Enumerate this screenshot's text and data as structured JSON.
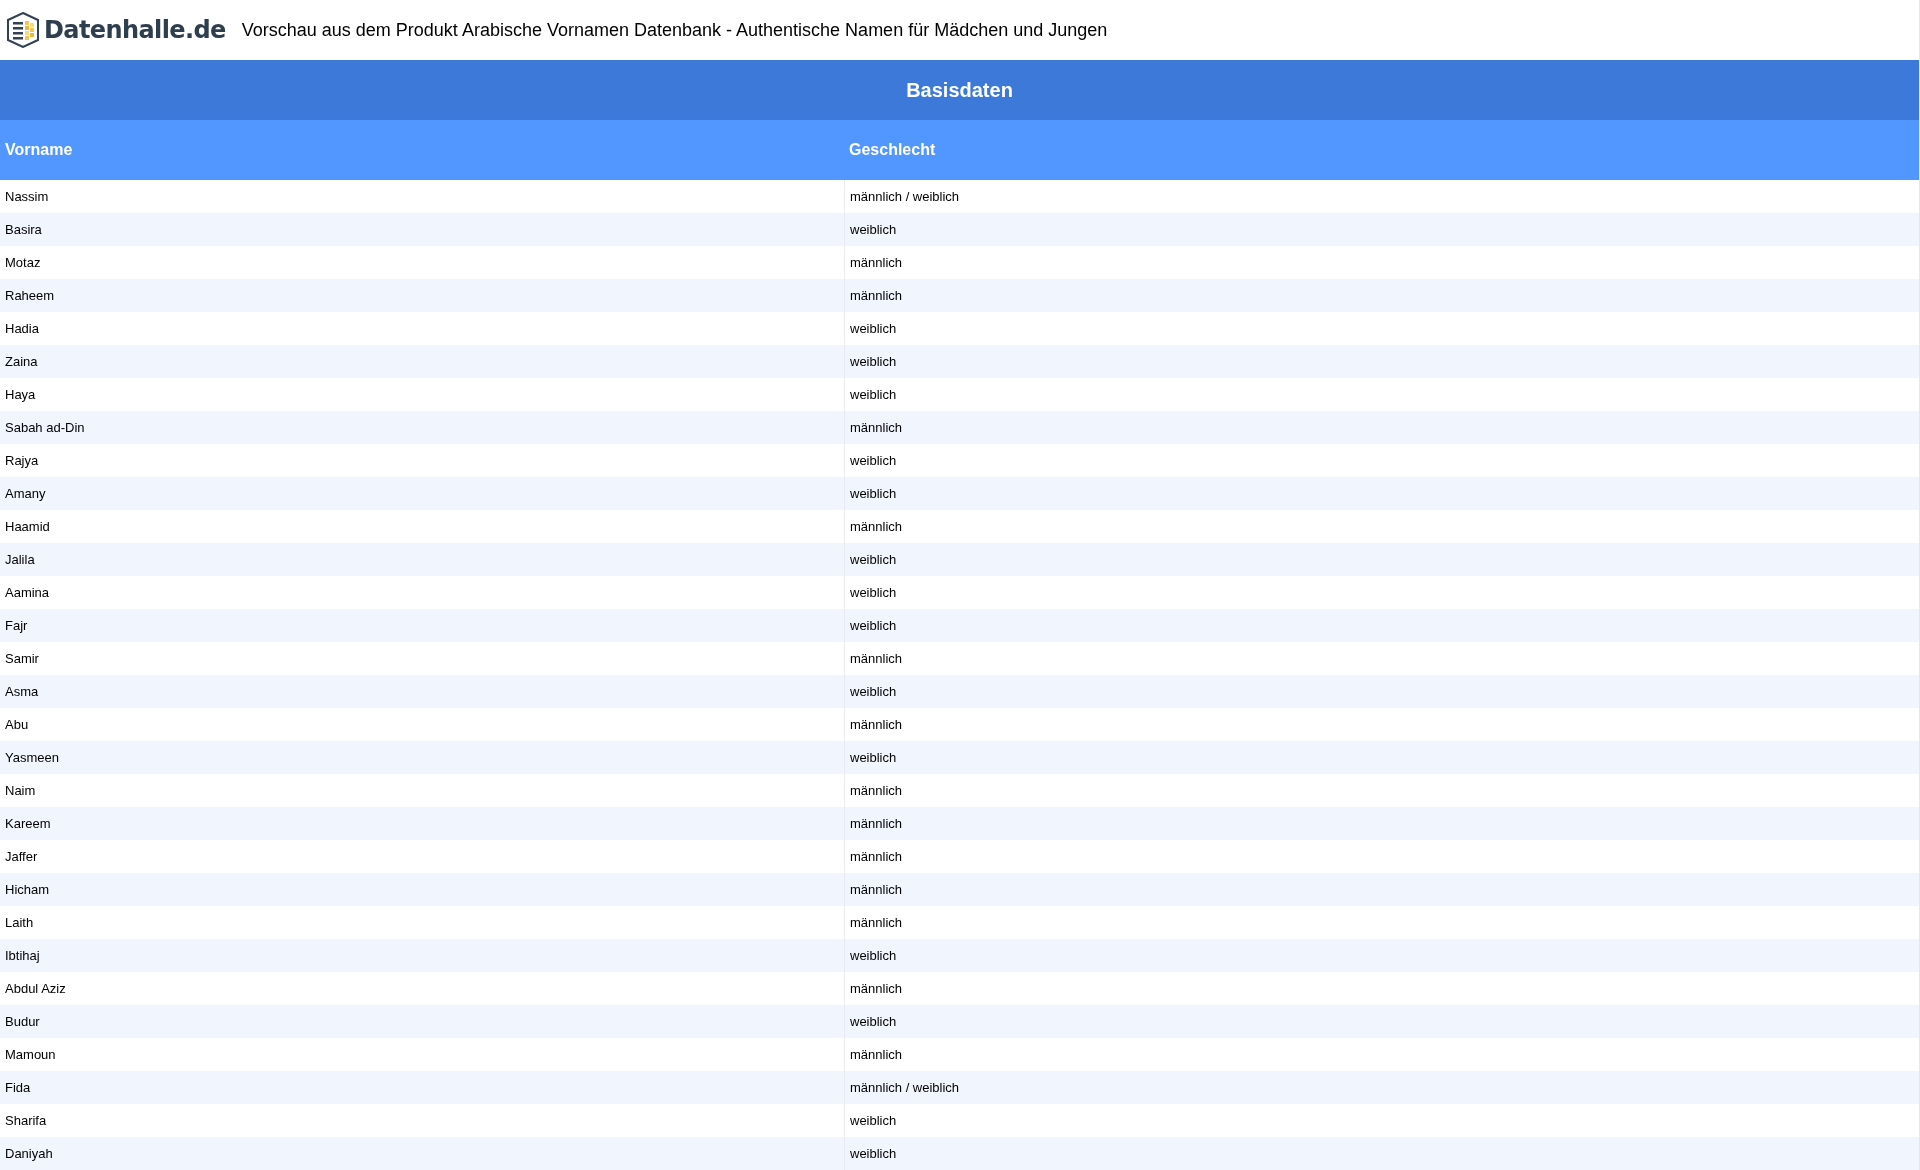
{
  "header": {
    "logo_text": "Datenhalle.de",
    "title": "Vorschau aus dem Produkt Arabische Vornamen Datenbank - Authentische Namen für Mädchen und Jungen"
  },
  "table": {
    "caption": "Basisdaten",
    "columns": [
      "Vorname",
      "Geschlecht"
    ],
    "rows": [
      [
        "Nassim",
        "männlich / weiblich"
      ],
      [
        "Basira",
        "weiblich"
      ],
      [
        "Motaz",
        "männlich"
      ],
      [
        "Raheem",
        "männlich"
      ],
      [
        "Hadia",
        "weiblich"
      ],
      [
        "Zaina",
        "weiblich"
      ],
      [
        "Haya",
        "weiblich"
      ],
      [
        "Sabah ad-Din",
        "männlich"
      ],
      [
        "Rajya",
        "weiblich"
      ],
      [
        "Amany",
        "weiblich"
      ],
      [
        "Haamid",
        "männlich"
      ],
      [
        "Jalila",
        "weiblich"
      ],
      [
        "Aamina",
        "weiblich"
      ],
      [
        "Fajr",
        "weiblich"
      ],
      [
        "Samir",
        "männlich"
      ],
      [
        "Asma",
        "weiblich"
      ],
      [
        "Abu",
        "männlich"
      ],
      [
        "Yasmeen",
        "weiblich"
      ],
      [
        "Naim",
        "männlich"
      ],
      [
        "Kareem",
        "männlich"
      ],
      [
        "Jaffer",
        "männlich"
      ],
      [
        "Hicham",
        "männlich"
      ],
      [
        "Laith",
        "männlich"
      ],
      [
        "Ibtihaj",
        "weiblich"
      ],
      [
        "Abdul Aziz",
        "männlich"
      ],
      [
        "Budur",
        "weiblich"
      ],
      [
        "Mamoun",
        "männlich"
      ],
      [
        "Fida",
        "männlich / weiblich"
      ],
      [
        "Sharifa",
        "weiblich"
      ],
      [
        "Daniyah",
        "weiblich"
      ]
    ]
  }
}
